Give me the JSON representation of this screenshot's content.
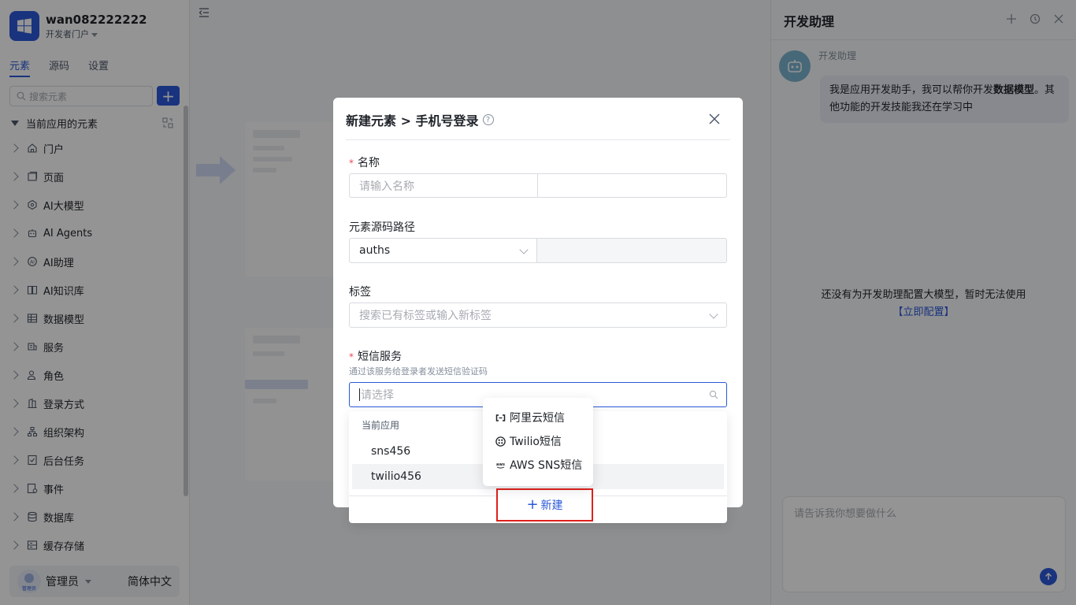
{
  "app": {
    "name": "wan082222222",
    "portal": "开发者门户"
  },
  "sidebar": {
    "tabs": [
      {
        "label": "元素",
        "active": true
      },
      {
        "label": "源码",
        "active": false
      },
      {
        "label": "设置",
        "active": false
      }
    ],
    "search_placeholder": "搜索元素",
    "add_label": "+",
    "tree_root": "当前应用的元素",
    "items": [
      {
        "label": "门户",
        "icon": "home-icon"
      },
      {
        "label": "页面",
        "icon": "page-icon"
      },
      {
        "label": "AI大模型",
        "icon": "model-icon"
      },
      {
        "label": "AI Agents",
        "icon": "robot-icon"
      },
      {
        "label": "AI助理",
        "icon": "assistant-icon"
      },
      {
        "label": "AI知识库",
        "icon": "book-icon"
      },
      {
        "label": "数据模型",
        "icon": "table-icon"
      },
      {
        "label": "服务",
        "icon": "service-icon"
      },
      {
        "label": "角色",
        "icon": "role-icon"
      },
      {
        "label": "登录方式",
        "icon": "login-icon"
      },
      {
        "label": "组织架构",
        "icon": "org-icon"
      },
      {
        "label": "后台任务",
        "icon": "task-icon"
      },
      {
        "label": "事件",
        "icon": "event-icon"
      },
      {
        "label": "数据库",
        "icon": "database-icon"
      },
      {
        "label": "缓存存储",
        "icon": "cache-icon"
      }
    ],
    "user": {
      "name": "管理员",
      "avatar_text": "管理员",
      "language": "简体中文"
    }
  },
  "assistant": {
    "title": "开发助理",
    "bot_name": "开发助理",
    "message_prefix": "我是应用开发助手，我可以帮你开发",
    "message_bold": "数据模型",
    "message_suffix": "。其他功能的开发技能我还在学习中",
    "empty_notice": "还没有为开发助理配置大模型，暂时无法使用",
    "config_link": "【立即配置】",
    "input_placeholder": "请告诉我你想要做什么"
  },
  "modal": {
    "title": "新建元素 > 手机号登录",
    "help_icon": "?",
    "fields": {
      "name": {
        "label": "名称",
        "required": "*",
        "placeholder": "请输入名称"
      },
      "source_path": {
        "label": "元素源码路径",
        "value": "auths"
      },
      "tags": {
        "label": "标签",
        "placeholder": "搜索已有标签或输入新标签"
      },
      "sms": {
        "label": "短信服务",
        "required": "*",
        "hint": "通过该服务给登录者发送短信验证码",
        "placeholder": "请选择"
      }
    },
    "dropdown": {
      "group_label": "当前应用",
      "options": [
        "sns456",
        "twilio456"
      ],
      "new_label": "新建"
    },
    "new_menu": [
      {
        "label": "阿里云短信",
        "icon": "aliyun-icon"
      },
      {
        "label": "Twilio短信",
        "icon": "twilio-icon"
      },
      {
        "label": "AWS SNS短信",
        "icon": "aws-icon"
      }
    ]
  },
  "colors": {
    "primary": "#2b59d9",
    "highlight_border": "#e0201b",
    "required": "#e34d59"
  }
}
